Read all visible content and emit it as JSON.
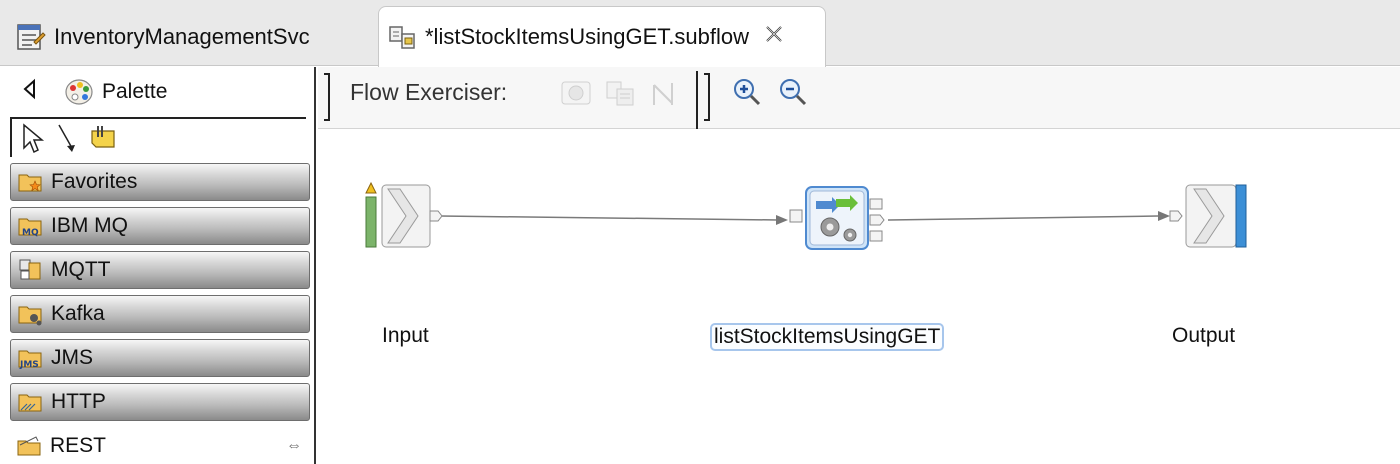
{
  "tabs": [
    {
      "label": "InventoryManagementSvc",
      "icon": "message-flow-icon",
      "active": false
    },
    {
      "label": "*listStockItemsUsingGET.subflow",
      "icon": "subflow-icon",
      "active": true,
      "close_icon": "close-icon"
    }
  ],
  "palette": {
    "title": "Palette",
    "collapse_icon": "triangle-left-icon",
    "tools": [
      "selection-arrow-icon",
      "connection-icon",
      "note-icon"
    ],
    "drawers": [
      {
        "label": "Favorites",
        "icon": "folder-star-icon"
      },
      {
        "label": "IBM MQ",
        "icon": "folder-mq-icon"
      },
      {
        "label": "MQTT",
        "icon": "mqtt-icon"
      },
      {
        "label": "Kafka",
        "icon": "folder-kafka-icon"
      },
      {
        "label": "JMS",
        "icon": "folder-jms-icon"
      },
      {
        "label": "HTTP",
        "icon": "folder-http-icon"
      },
      {
        "label": "REST",
        "icon": "folder-rest-icon",
        "pin_glyph": "⇔"
      }
    ]
  },
  "toolbar": {
    "flow_exerciser_label": "Flow Exerciser:",
    "buttons": [
      "record-icon",
      "view-messages-icon",
      "send-message-icon"
    ],
    "zoom_in": "zoom-in-icon",
    "zoom_out": "zoom-out-icon"
  },
  "flow": {
    "nodes": [
      {
        "label": "Input",
        "type": "input-node"
      },
      {
        "label": "listStockItemsUsingGET",
        "type": "rest-request-node",
        "selected": true
      },
      {
        "label": "Output",
        "type": "output-node"
      }
    ]
  },
  "colors": {
    "tab_bar_bg": "#e9e9e9",
    "selection_border": "#a7c6ec",
    "connection_line": "#7a7a7a",
    "input_terminal_green": "#7cb46a",
    "output_terminal_blue": "#3c8fd6"
  }
}
